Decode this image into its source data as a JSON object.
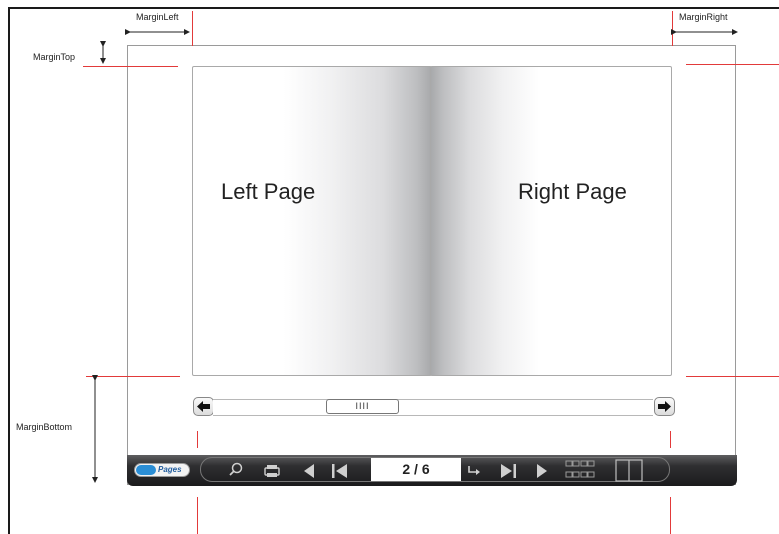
{
  "labels": {
    "margin_left": "MarginLeft",
    "margin_right": "MarginRight",
    "margin_top": "MarginTop",
    "margin_bottom": "MarginBottom"
  },
  "book": {
    "left_page": "Left Page",
    "right_page": "Right Page"
  },
  "scrollbar": {
    "thumb_grip": "IIII"
  },
  "toolbar": {
    "logo_text": "Pages",
    "page_indicator": "2 / 6",
    "icons": [
      "search-icon",
      "print-icon",
      "prev-page-icon",
      "first-page-icon",
      "goto-icon",
      "last-page-icon",
      "next-page-icon",
      "thumbnails-icon",
      "single-page-icon"
    ]
  },
  "colors": {
    "guide": "#e23a3a",
    "frame": "#9a9a9a",
    "toolbar": "#1b1b1c"
  }
}
